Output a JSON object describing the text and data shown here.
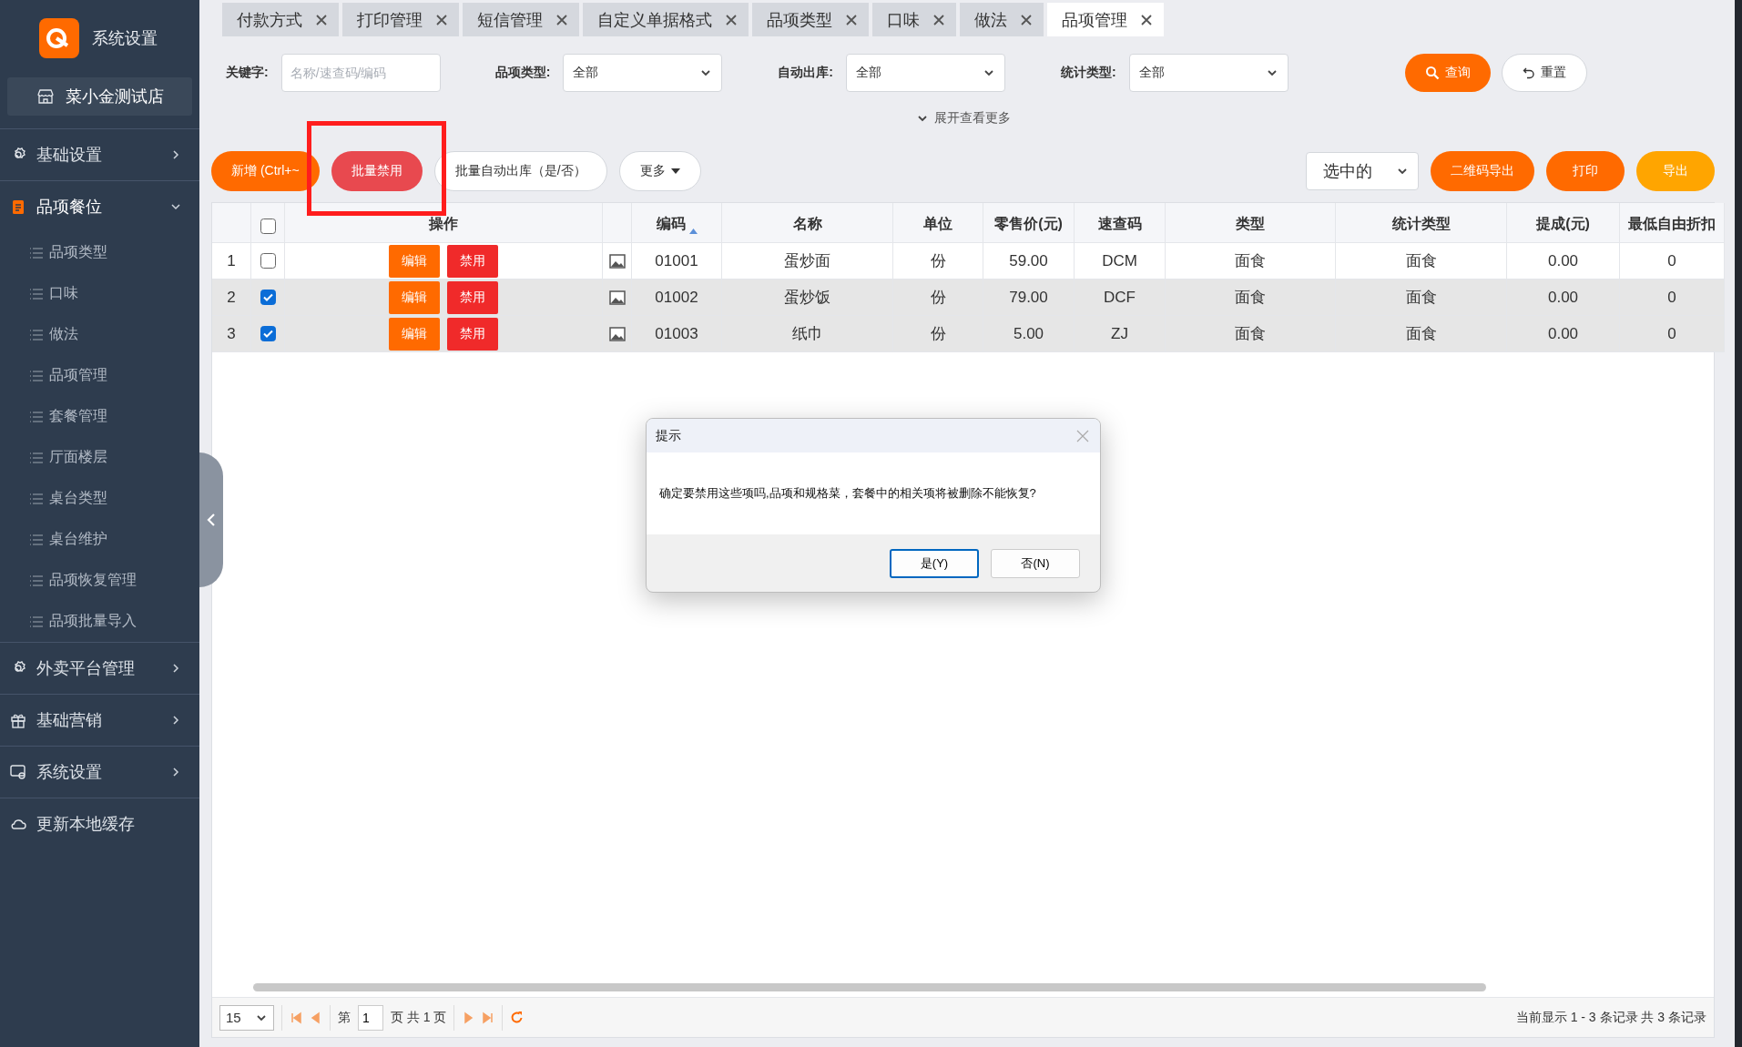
{
  "sidebar": {
    "app_title": "系统设置",
    "store": "菜小金测试店",
    "groups": [
      {
        "label": "基础设置",
        "expanded": false,
        "chevron": true
      },
      {
        "label": "品项餐位",
        "expanded": true,
        "chevron": true,
        "children": [
          {
            "label": "品项类型"
          },
          {
            "label": "口味"
          },
          {
            "label": "做法"
          },
          {
            "label": "品项管理"
          },
          {
            "label": "套餐管理"
          },
          {
            "label": "厅面楼层"
          },
          {
            "label": "桌台类型"
          },
          {
            "label": "桌台维护"
          },
          {
            "label": "品项恢复管理"
          },
          {
            "label": "品项批量导入"
          }
        ]
      },
      {
        "label": "外卖平台管理",
        "expanded": false,
        "chevron": true
      },
      {
        "label": "基础营销",
        "expanded": false,
        "chevron": true
      },
      {
        "label": "系统设置",
        "expanded": false,
        "chevron": true
      },
      {
        "label": "更新本地缓存",
        "expanded": false,
        "chevron": false
      }
    ]
  },
  "tabs": [
    {
      "label": "付款方式",
      "selected": false
    },
    {
      "label": "打印管理",
      "selected": false
    },
    {
      "label": "短信管理",
      "selected": false
    },
    {
      "label": "自定义单据格式",
      "selected": false
    },
    {
      "label": "品项类型",
      "selected": false
    },
    {
      "label": "口味",
      "selected": false
    },
    {
      "label": "做法",
      "selected": false
    },
    {
      "label": "品项管理",
      "selected": true
    }
  ],
  "filters": {
    "keyword": {
      "label": "关键字:",
      "placeholder": "名称/速查码/编码"
    },
    "selects": [
      {
        "label": "品项类型:",
        "value": "全部"
      },
      {
        "label": "自动出库:",
        "value": "全部"
      },
      {
        "label": "统计类型:",
        "value": "全部"
      }
    ],
    "query": "查询",
    "reset": "重置",
    "expand": "展开查看更多"
  },
  "toolbar": {
    "left": [
      {
        "label": "新增 (Ctrl+~",
        "kind": "primary"
      },
      {
        "label": "批量禁用",
        "kind": "danger"
      },
      {
        "label": "批量自动出库（是/否）",
        "kind": "plain"
      },
      {
        "label": "更多",
        "kind": "dropdown"
      }
    ],
    "scope": "选中的",
    "right": [
      {
        "label": "二维码导出",
        "kind": "primary"
      },
      {
        "label": "打印",
        "kind": "primary"
      },
      {
        "label": "导出",
        "kind": "warning"
      }
    ]
  },
  "table": {
    "action_column": "操作",
    "columns": [
      "编码",
      "名称",
      "单位",
      "零售价(元)",
      "速查码",
      "类型",
      "统计类型",
      "提成(元)",
      "最低自由折扣"
    ],
    "all_checked": false,
    "rows": [
      {
        "index": "1",
        "checked": false,
        "edit": "编辑",
        "disable": "禁用",
        "cells": [
          "01001",
          "蛋炒面",
          "份",
          "59.00",
          "DCM",
          "面食",
          "面食",
          "0.00",
          "0"
        ]
      },
      {
        "index": "2",
        "checked": true,
        "edit": "编辑",
        "disable": "禁用",
        "cells": [
          "01002",
          "蛋炒饭",
          "份",
          "79.00",
          "DCF",
          "面食",
          "面食",
          "0.00",
          "0"
        ]
      },
      {
        "index": "3",
        "checked": true,
        "edit": "编辑",
        "disable": "禁用",
        "cells": [
          "01003",
          "纸巾",
          "份",
          "5.00",
          "ZJ",
          "面食",
          "面食",
          "0.00",
          "0"
        ]
      }
    ]
  },
  "pager": {
    "size": "15",
    "page_prefix": "第",
    "page": "1",
    "page_suffix": "页 共 1 页",
    "summary": "当前显示 1 - 3 条记录 共 3 条记录"
  },
  "dialog": {
    "title": "提示",
    "message": "确定要禁用这些项吗,品项和规格菜，套餐中的相关项将被删除不能恢复?",
    "buttons": [
      {
        "label": "是(Y)",
        "default": true
      },
      {
        "label": "否(N)",
        "default": false
      }
    ]
  }
}
